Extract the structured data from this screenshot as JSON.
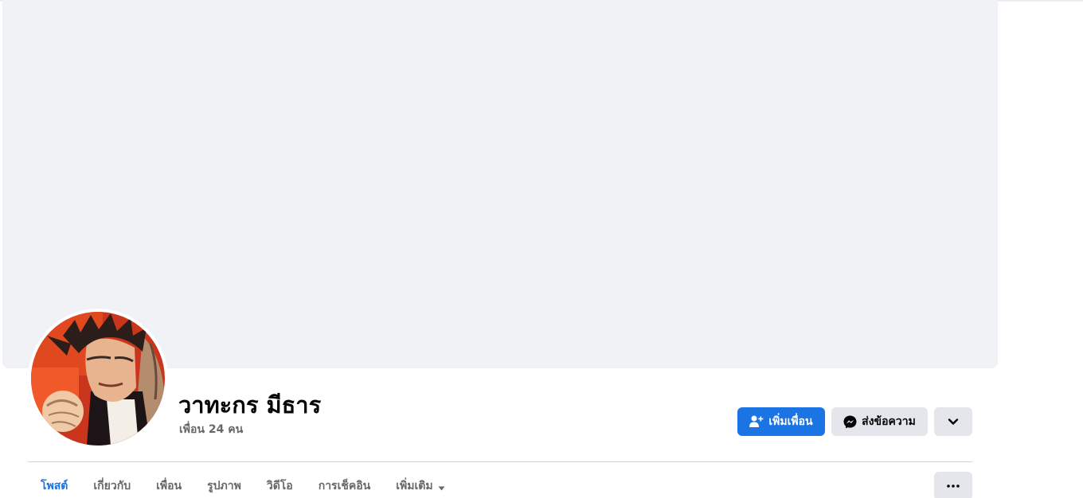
{
  "profile": {
    "name": "วาทะกร มีธาร",
    "friends_text": "เพื่อน 24 คน"
  },
  "actions": {
    "add_friend_label": "เพิ่มเพื่อน",
    "message_label": "ส่งข้อความ",
    "more_icon": "chevron-down-icon"
  },
  "tabs": [
    {
      "label": "โพสต์",
      "active": true
    },
    {
      "label": "เกี่ยวกับ",
      "active": false
    },
    {
      "label": "เพื่อน",
      "active": false
    },
    {
      "label": "รูปภาพ",
      "active": false
    },
    {
      "label": "วิดีโอ",
      "active": false
    },
    {
      "label": "การเช็คอิน",
      "active": false
    },
    {
      "label": "เพิ่มเติม",
      "active": false
    }
  ],
  "colors": {
    "accent": "#1b74e4",
    "cover": "#f0f2f5",
    "secondary_button": "#e4e6eb",
    "muted_text": "#65676b"
  }
}
